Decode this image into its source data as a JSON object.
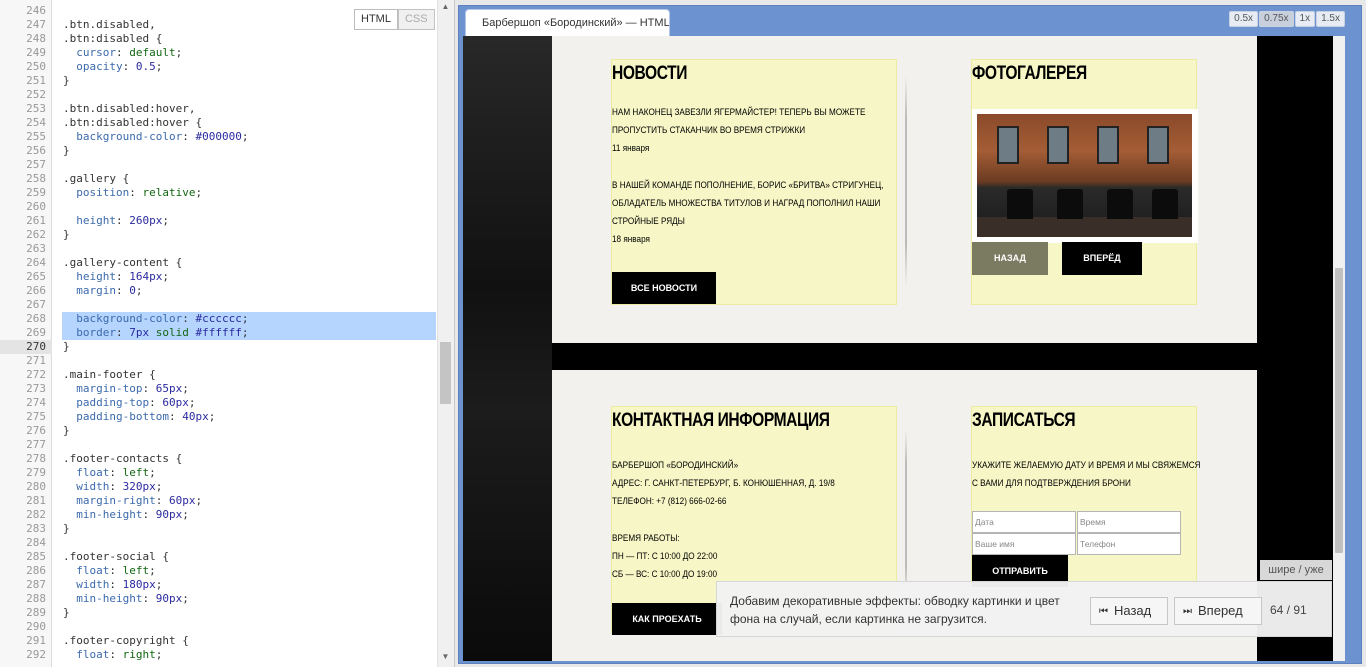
{
  "editor": {
    "mode_html": "HTML",
    "mode_css": "CSS",
    "current_line": "270",
    "lines": [
      {
        "n": "246",
        "t": ""
      },
      {
        "n": "247",
        "t": ".btn.disabled,"
      },
      {
        "n": "248",
        "t": ".btn:disabled {"
      },
      {
        "n": "249",
        "t": "  cursor: default;"
      },
      {
        "n": "250",
        "t": "  opacity: 0.5;"
      },
      {
        "n": "251",
        "t": "}"
      },
      {
        "n": "252",
        "t": ""
      },
      {
        "n": "253",
        "t": ".btn.disabled:hover,"
      },
      {
        "n": "254",
        "t": ".btn:disabled:hover {"
      },
      {
        "n": "255",
        "t": "  background-color: #000000;"
      },
      {
        "n": "256",
        "t": "}"
      },
      {
        "n": "257",
        "t": ""
      },
      {
        "n": "258",
        "t": ".gallery {"
      },
      {
        "n": "259",
        "t": "  position: relative;"
      },
      {
        "n": "260",
        "t": ""
      },
      {
        "n": "261",
        "t": "  height: 260px;"
      },
      {
        "n": "262",
        "t": "}"
      },
      {
        "n": "263",
        "t": ""
      },
      {
        "n": "264",
        "t": ".gallery-content {"
      },
      {
        "n": "265",
        "t": "  height: 164px;"
      },
      {
        "n": "266",
        "t": "  margin: 0;"
      },
      {
        "n": "267",
        "t": ""
      },
      {
        "n": "268",
        "t": "  background-color: #cccccc;"
      },
      {
        "n": "269",
        "t": "  border: 7px solid #ffffff;"
      },
      {
        "n": "270",
        "t": "}"
      },
      {
        "n": "271",
        "t": ""
      },
      {
        "n": "272",
        "t": ".main-footer {"
      },
      {
        "n": "273",
        "t": "  margin-top: 65px;"
      },
      {
        "n": "274",
        "t": "  padding-top: 60px;"
      },
      {
        "n": "275",
        "t": "  padding-bottom: 40px;"
      },
      {
        "n": "276",
        "t": "}"
      },
      {
        "n": "277",
        "t": ""
      },
      {
        "n": "278",
        "t": ".footer-contacts {"
      },
      {
        "n": "279",
        "t": "  float: left;"
      },
      {
        "n": "280",
        "t": "  width: 320px;"
      },
      {
        "n": "281",
        "t": "  margin-right: 60px;"
      },
      {
        "n": "282",
        "t": "  min-height: 90px;"
      },
      {
        "n": "283",
        "t": "}"
      },
      {
        "n": "284",
        "t": ""
      },
      {
        "n": "285",
        "t": ".footer-social {"
      },
      {
        "n": "286",
        "t": "  float: left;"
      },
      {
        "n": "287",
        "t": "  width: 180px;"
      },
      {
        "n": "288",
        "t": "  min-height: 90px;"
      },
      {
        "n": "289",
        "t": "}"
      },
      {
        "n": "290",
        "t": ""
      },
      {
        "n": "291",
        "t": ".footer-copyright {"
      },
      {
        "n": "292",
        "t": "  float: right;"
      }
    ]
  },
  "preview": {
    "tab_title": "Барбершоп «Бородинский» — HTML",
    "zooms": [
      "0.5x",
      "0.75x",
      "1x",
      "1.5x"
    ],
    "active_zoom": "0.75x"
  },
  "site": {
    "news": {
      "heading": "НОВОСТИ",
      "item1_line1": "НАМ НАКОНЕЦ ЗАВЕЗЛИ ЯГЕРМАЙСТЕР! ТЕПЕРЬ ВЫ МОЖЕТЕ",
      "item1_line2": "ПРОПУСТИТЬ СТАКАНЧИК ВО ВРЕМЯ СТРИЖКИ",
      "item1_date": "11 января",
      "item2_line1": "В НАШЕЙ КОМАНДЕ ПОПОЛНЕНИЕ, БОРИС «БРИТВА» СТРИГУНЕЦ,",
      "item2_line2": "ОБЛАДАТЕЛЬ МНОЖЕСТВА ТИТУЛОВ И НАГРАД ПОПОЛНИЛ НАШИ",
      "item2_line3": "СТРОЙНЫЕ РЯДЫ",
      "item2_date": "18 января",
      "all_button": "ВСЕ НОВОСТИ"
    },
    "gallery": {
      "heading": "ФОТОГАЛЕРЕЯ",
      "back_button": "НАЗАД",
      "next_button": "ВПЕРЁД"
    },
    "contacts": {
      "heading": "КОНТАКТНАЯ ИНФОРМАЦИЯ",
      "line1": "БАРБЕРШОП «БОРОДИНСКИЙ»",
      "line2": "АДРЕС: Г. САНКТ-ПЕТЕРБУРГ, Б. КОНЮШЕННАЯ, Д. 19/8",
      "line3": "ТЕЛЕФОН: +7 (812) 666-02-66",
      "hours_title": "ВРЕМЯ РАБОТЫ:",
      "hours1": "ПН — ПТ: С 10:00 ДО 22:00",
      "hours2": "СБ — ВС: С 10:00 ДО 19:00",
      "route_button": "КАК ПРОЕХАТЬ"
    },
    "signup": {
      "heading": "ЗАПИСАТЬСЯ",
      "line1": "УКАЖИТЕ ЖЕЛАЕМУЮ ДАТУ И ВРЕМЯ И МЫ СВЯЖЕМСЯ",
      "line2": "С ВАМИ ДЛЯ ПОДТВЕРЖДЕНИЯ БРОНИ",
      "date_placeholder": "Дата",
      "time_placeholder": "Время",
      "name_placeholder": "Ваше имя",
      "phone_placeholder": "Телефон",
      "submit_button": "ОТПРАВИТЬ"
    }
  },
  "tutorial": {
    "width_toggle": "шире / уже",
    "text": "Добавим декоративные эффекты: обводку картинки и цвет фона на случай, если картинка не загрузится.",
    "back_button": "Назад",
    "next_button": "Вперед",
    "counter": "64 / 91"
  }
}
